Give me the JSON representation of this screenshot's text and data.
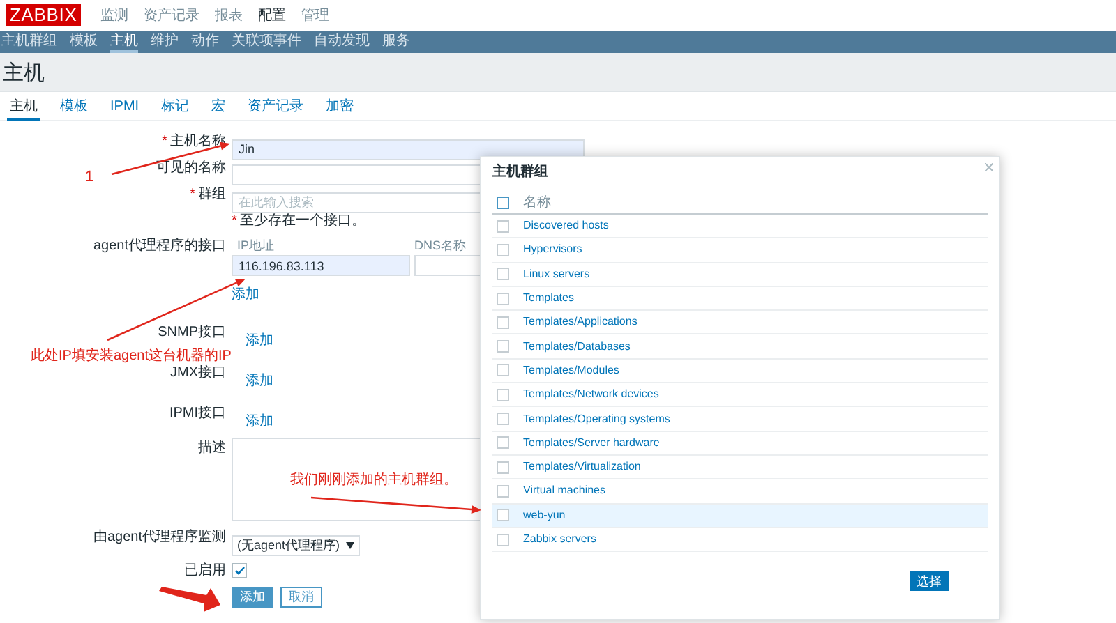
{
  "header": {
    "logo": "ZABBIX",
    "menu": [
      {
        "label": "监测",
        "selected": false
      },
      {
        "label": "资产记录",
        "selected": false
      },
      {
        "label": "报表",
        "selected": false
      },
      {
        "label": "配置",
        "selected": true
      },
      {
        "label": "管理",
        "selected": false
      }
    ]
  },
  "subnav": [
    {
      "label": "主机群组",
      "selected": false
    },
    {
      "label": "模板",
      "selected": false
    },
    {
      "label": "主机",
      "selected": true
    },
    {
      "label": "维护",
      "selected": false
    },
    {
      "label": "动作",
      "selected": false
    },
    {
      "label": "关联项事件",
      "selected": false
    },
    {
      "label": "自动发现",
      "selected": false
    },
    {
      "label": "服务",
      "selected": false
    }
  ],
  "page_title": "主机",
  "tabs": [
    {
      "label": "主机",
      "selected": true
    },
    {
      "label": "模板",
      "selected": false
    },
    {
      "label": "IPMI",
      "selected": false
    },
    {
      "label": "标记",
      "selected": false
    },
    {
      "label": "宏",
      "selected": false
    },
    {
      "label": "资产记录",
      "selected": false
    },
    {
      "label": "加密",
      "selected": false
    }
  ],
  "form": {
    "host_name": {
      "required_mark": "*",
      "label": "主机名称",
      "value": "Jin"
    },
    "visible_name": {
      "label": "可见的名称"
    },
    "groups": {
      "required_mark": "*",
      "label": "群组",
      "placeholder": "在此输入搜索"
    },
    "interface_note": {
      "required_mark": "*",
      "text": "至少存在一个接口。"
    },
    "interfaces": [
      {
        "label": "agent代理程序的接口",
        "columns": [
          "IP地址",
          "DNS名称"
        ],
        "ip": "116.196.83.113",
        "add": "添加"
      },
      {
        "label": "SNMP接口",
        "add": "添加"
      },
      {
        "label": "JMX接口",
        "add": "添加"
      },
      {
        "label": "IPMI接口",
        "add": "添加"
      }
    ],
    "description": {
      "label": "描述"
    },
    "proxy": {
      "label": "由agent代理程序监测",
      "value": "(无agent代理程序)"
    },
    "enabled": {
      "label": "已启用",
      "checked": true
    },
    "buttons": [
      {
        "label": "添加",
        "kind": "primary"
      },
      {
        "label": "取消",
        "kind": "secondary"
      }
    ]
  },
  "dialog": {
    "title": "主机群组",
    "header": "名称",
    "header_checked": false,
    "items": [
      {
        "name": "Discovered hosts",
        "checked": false,
        "selected": false
      },
      {
        "name": "Hypervisors",
        "checked": false,
        "selected": false
      },
      {
        "name": "Linux servers",
        "checked": false,
        "selected": false
      },
      {
        "name": "Templates",
        "checked": false,
        "selected": false
      },
      {
        "name": "Templates/Applications",
        "checked": false,
        "selected": false
      },
      {
        "name": "Templates/Databases",
        "checked": false,
        "selected": false
      },
      {
        "name": "Templates/Modules",
        "checked": false,
        "selected": false
      },
      {
        "name": "Templates/Network devices",
        "checked": false,
        "selected": false
      },
      {
        "name": "Templates/Operating systems",
        "checked": false,
        "selected": false
      },
      {
        "name": "Templates/Server hardware",
        "checked": false,
        "selected": false
      },
      {
        "name": "Templates/Virtualization",
        "checked": false,
        "selected": false
      },
      {
        "name": "Virtual machines",
        "checked": false,
        "selected": false
      },
      {
        "name": "web-yun",
        "checked": false,
        "selected": true
      },
      {
        "name": "Zabbix servers",
        "checked": false,
        "selected": false
      }
    ],
    "buttons": [
      {
        "label": "选择"
      }
    ]
  },
  "annotations": [
    {
      "text": "1"
    },
    {
      "text": "此处IP填安装agent这台机器的IP"
    },
    {
      "text": "我们刚刚添加的主机群组。"
    }
  ]
}
